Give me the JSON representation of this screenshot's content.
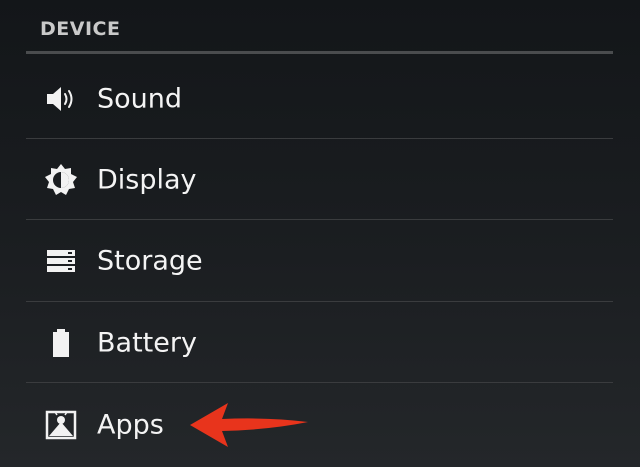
{
  "section": {
    "title": "DEVICE"
  },
  "items": [
    {
      "label": "Sound",
      "icon": "speaker-icon"
    },
    {
      "label": "Display",
      "icon": "brightness-icon"
    },
    {
      "label": "Storage",
      "icon": "storage-icon"
    },
    {
      "label": "Battery",
      "icon": "battery-icon"
    },
    {
      "label": "Apps",
      "icon": "apps-icon"
    }
  ],
  "annotation": {
    "icon": "red-arrow-icon",
    "color": "#e8341c"
  },
  "colors": {
    "background": "#1b1e21",
    "divider": "#3a3c3e",
    "header_text": "#c9c9c9",
    "item_text": "#f4f4f4"
  }
}
